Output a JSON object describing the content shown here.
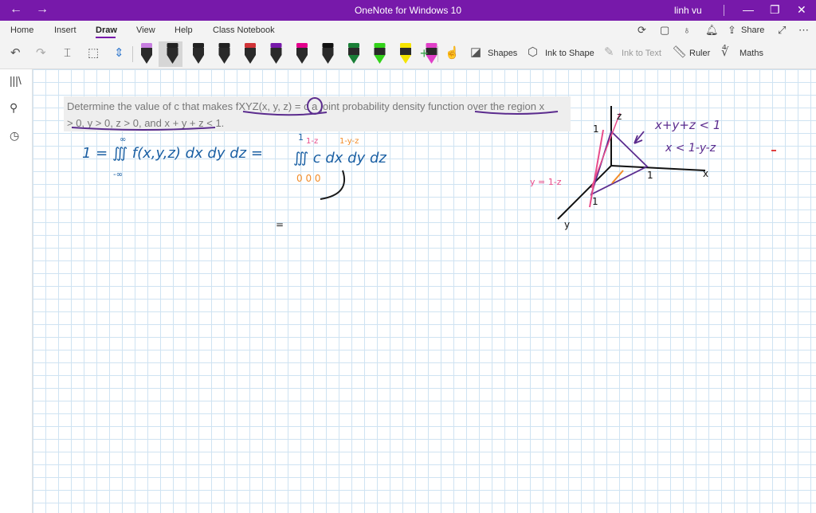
{
  "titlebar": {
    "back": "←",
    "forward": "→",
    "title": "OneNote for Windows 10",
    "user": "linh vu",
    "minimize": "—",
    "restore": "❐",
    "close": "✕"
  },
  "tabs": [
    "Home",
    "Insert",
    "Draw",
    "View",
    "Help",
    "Class Notebook"
  ],
  "active_tab": "Draw",
  "tabbar_right": {
    "share": "Share",
    "more": "⋯"
  },
  "toolbar": {
    "shapes": "Shapes",
    "ink_to_shape": "Ink to Shape",
    "ink_to_text": "Ink to Text",
    "ruler": "Ruler",
    "maths": "Maths",
    "pen_colors": [
      "#c77ee0",
      "#222222",
      "#222222",
      "#222222",
      "#d13438",
      "#7719aa",
      "#e3008c",
      "#111111",
      "#1a7f37",
      "#33d21a",
      "#f5e400",
      "#e040c8"
    ]
  },
  "question": {
    "text_line1": "Determine the value of c that makes fXYZ(x, y, z) = c a joint probability density function over the region x",
    "text_line2": "> 0, y > 0, z > 0, and x + y + z < 1."
  },
  "handwriting": {
    "eq_left": "1 = ∭ f(x,y,z) dx dy dz =",
    "lower_limit": "-∞",
    "upper_limit": "∞",
    "eq_right": "∭ c dx dy dz",
    "limits_outer": "1",
    "limits_mid": "1-z",
    "limits_inner": "1-y-z",
    "zeros": "0  0  0",
    "stray": "=",
    "constraint1": "x+y+z < 1",
    "constraint2": "x < 1-y-z",
    "pink_label": "y = 1-z",
    "axis_z": "z",
    "axis_x": "x",
    "axis_y": "y",
    "one_z": "1",
    "one_x": "1",
    "one_y": "1"
  },
  "colors": {
    "accent": "#7719aa",
    "ink_blue": "#1a5fa3",
    "ink_purple": "#5b2c8e",
    "ink_pink": "#e84c8b",
    "ink_orange": "#f28c28",
    "ink_red": "#e04040"
  }
}
